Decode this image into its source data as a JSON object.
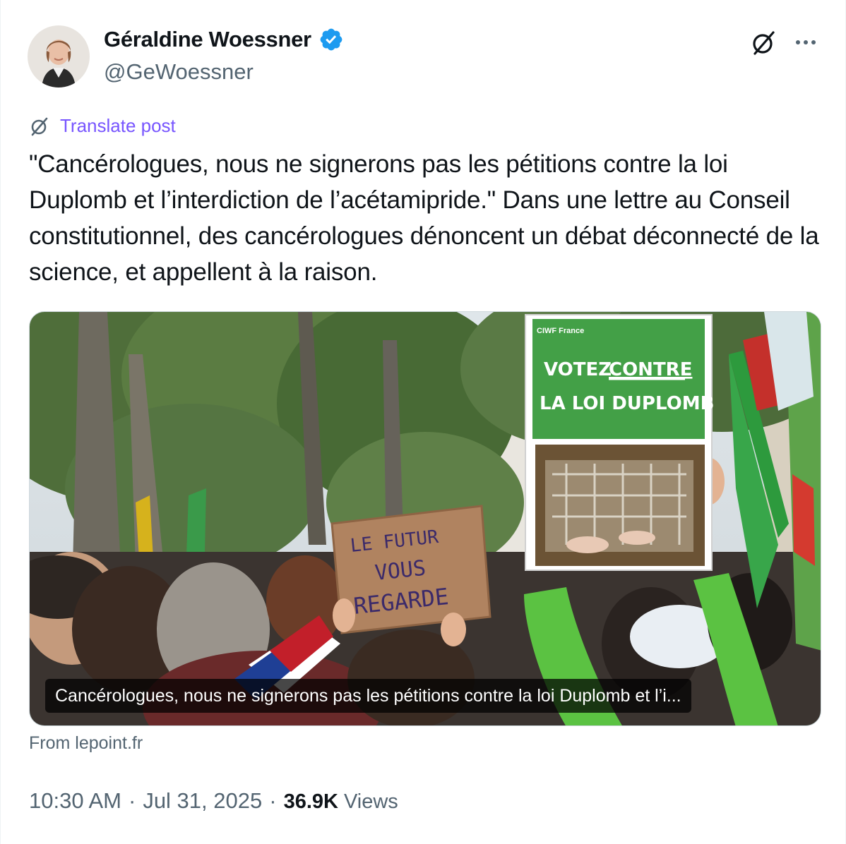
{
  "author": {
    "name": "Géraldine Woessner",
    "handle": "@GeWoessner",
    "verified": true
  },
  "actions": {
    "grok_icon": "grok-slash-icon",
    "more_icon": "more-horizontal-icon"
  },
  "translate": {
    "label": "Translate post",
    "icon": "translate-icon"
  },
  "post": {
    "text": "\"Cancérologues, nous ne signerons pas les pétitions contre la loi Duplomb et l’interdiction de l’acétamipride.\" Dans une lettre au Conseil constitutionnel, des cancérologues dénoncent un débat déconnecté de la science, et appellent à la raison."
  },
  "card": {
    "caption": "Cancérologues, nous ne signerons pas les pétitions contre la loi Duplomb et l’i...",
    "sign_green_line1": "VOTEZ",
    "sign_green_line1_underlined": "CONTRE",
    "sign_green_line2": "LA LOI DUPLOMB",
    "sign_green_logo": "CIWF France",
    "sign_cardboard_line1": "LE FUTUR",
    "sign_cardboard_line2": "VOUS",
    "sign_cardboard_line3": "REGARDE"
  },
  "source": {
    "label": "From lepoint.fr"
  },
  "meta": {
    "time": "10:30 AM",
    "date": "Jul 31, 2025",
    "separator": "·",
    "views_count": "36.9K",
    "views_label": "Views"
  },
  "colors": {
    "verified_blue": "#1d9bf0",
    "translate_purple": "#7856ff",
    "secondary_text": "#536471",
    "primary_text": "#0f1419",
    "sign_green": "#43a047"
  }
}
